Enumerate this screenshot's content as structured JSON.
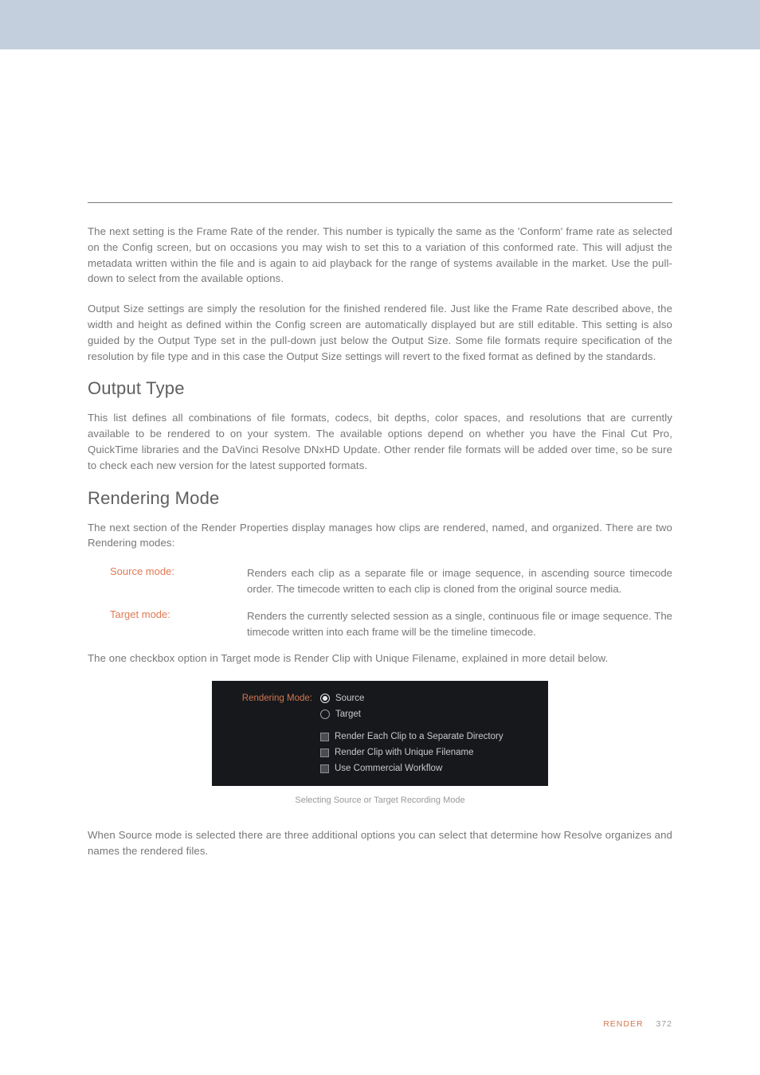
{
  "paragraphs": {
    "p1": "The next setting is the Frame Rate of the render. This number is typically the same as the 'Conform' frame rate as selected on the Config screen, but on occasions you may wish to set this to a variation of this conformed rate. This will adjust the metadata written within the file and is again to aid playback for the range of systems available in the market. Use the pull-down to select from the available options.",
    "p2": "Output Size settings are simply the resolution for the finished rendered file. Just like the Frame Rate described above, the width and height as defined within the Config screen are automatically displayed but are still editable. This setting is also guided by the Output Type set in the pull-down just below the Output Size. Some file formats require specification of the resolution by file type and in this case the Output Size settings will revert to the fixed format as defined by the standards.",
    "p3": "This list defines all combinations of file formats, codecs, bit depths, color spaces, and resolutions that are currently available to be rendered to on your system. The available options depend on whether you have the Final Cut Pro, QuickTime libraries and the DaVinci Resolve DNxHD Update. Other render file formats will be added over time, so be sure to check each new version for the latest supported formats.",
    "p4": "The next section of the Render Properties display manages how clips are rendered, named, and organized. There are two Rendering modes:",
    "p5": "The one checkbox option in Target mode is Render Clip with Unique Filename, explained in more detail below.",
    "p6": "When Source mode is selected there are three additional options you can select that determine how Resolve organizes and names the rendered files."
  },
  "headings": {
    "h1": "Output Type",
    "h2": "Rendering Mode"
  },
  "defs": {
    "source": {
      "term": "Source mode:",
      "desc": "Renders each clip as a separate file or image sequence, in ascending source timecode order. The timecode written to each clip is cloned from the original source media."
    },
    "target": {
      "term": "Target mode:",
      "desc": "Renders the currently selected session as a single, continuous file or image sequence. The timecode written into each frame will be the timeline timecode."
    }
  },
  "figure": {
    "label": "Rendering Mode:",
    "radios": {
      "source": "Source",
      "target": "Target"
    },
    "checks": {
      "separate": "Render Each Clip to a Separate Directory",
      "unique": "Render Clip with Unique Filename",
      "commercial": "Use Commercial Workflow"
    }
  },
  "caption": "Selecting Source or Target Recording Mode",
  "footer": {
    "section": "RENDER",
    "page": "372"
  }
}
